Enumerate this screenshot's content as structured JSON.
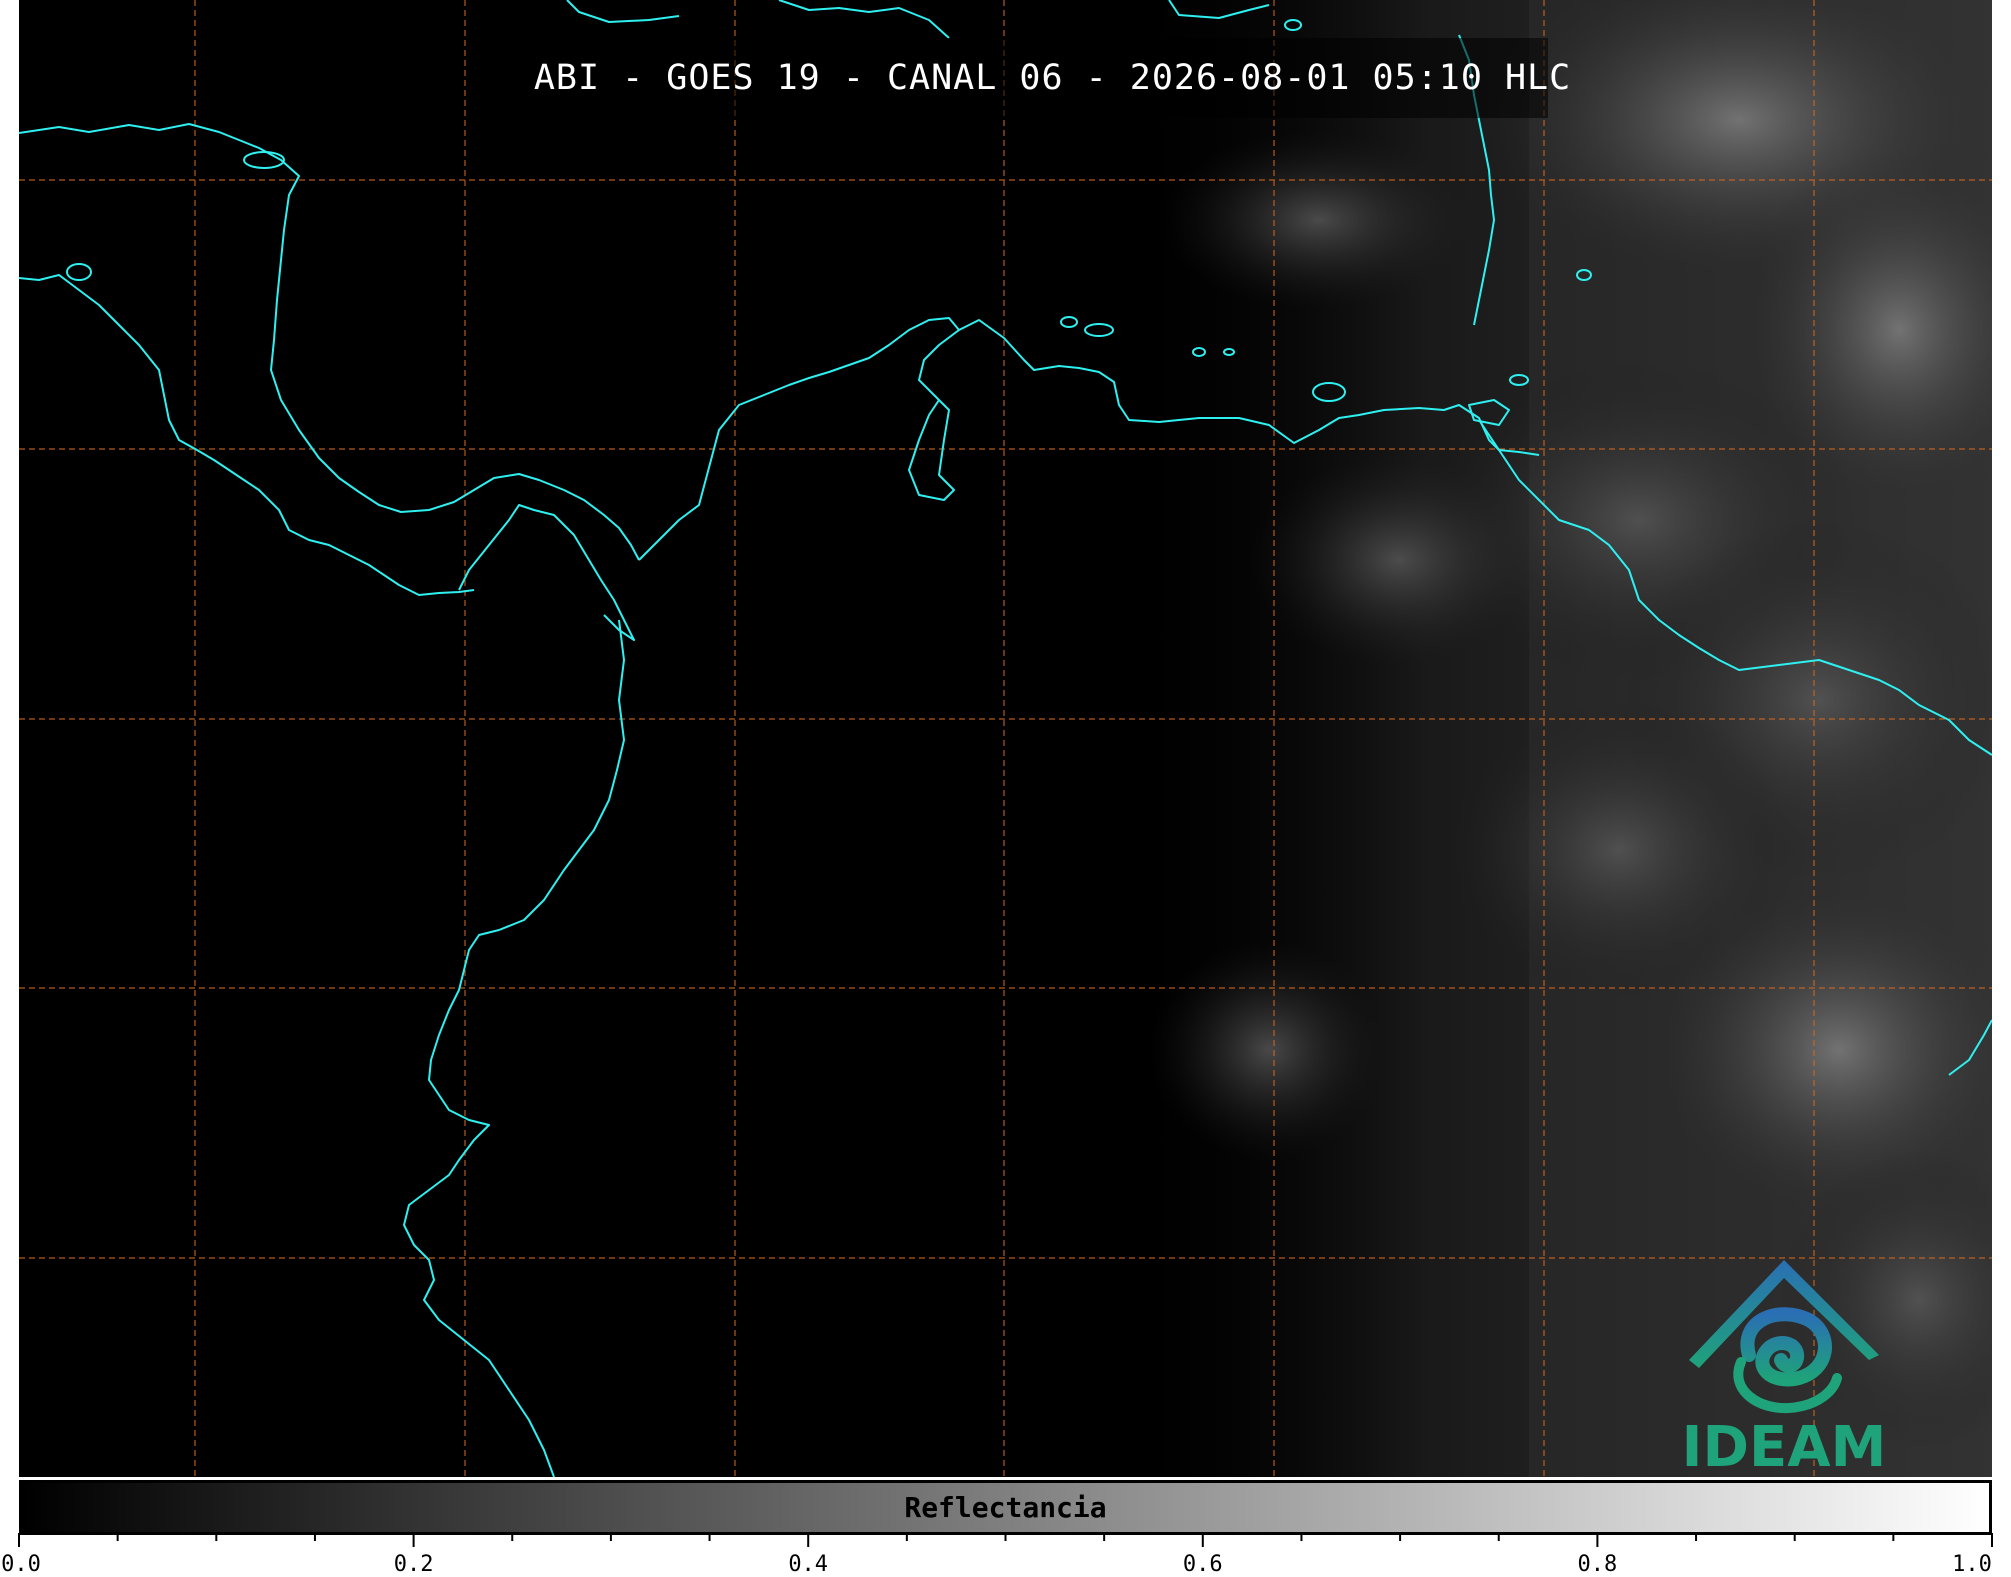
{
  "title": "ABI - GOES 19 - CANAL 06 - 2026-08-01 05:10 HLC",
  "logo": {
    "text": "IDEAM",
    "icon": "ideam-logo-icon"
  },
  "colorbar": {
    "label": "Reflectancia",
    "range": [
      0.0,
      1.0
    ],
    "major_ticks": [
      "0.0",
      "0.2",
      "0.4",
      "0.6",
      "0.8",
      "1.0"
    ],
    "minor_step": 0.05,
    "colormap": [
      "#000000",
      "#ffffff"
    ]
  },
  "map": {
    "coastline_color": "#2ff0f0",
    "gridline_color": "#d2691e",
    "gridline_style": "dashed",
    "background": "#000000"
  }
}
